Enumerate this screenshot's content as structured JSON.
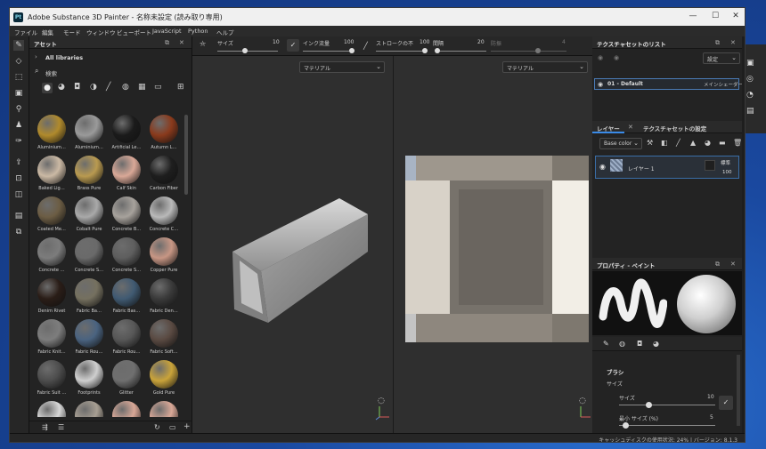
{
  "app": {
    "title": "Adobe Substance 3D Painter - 名称未設定 (読み取り専用)",
    "logo_text": "Pt",
    "controls": [
      "—",
      "☐",
      "✕"
    ]
  },
  "menu": [
    "ファイル",
    "編集",
    "モード",
    "ウィンドウ",
    "ビューポート",
    "JavaScript",
    "Python",
    "ヘルプ"
  ],
  "assets_panel": {
    "title": "アセット",
    "library": "All libraries",
    "search_placeholder": "検索",
    "items": [
      {
        "name": "Aluminium…",
        "color": "#b08a2c"
      },
      {
        "name": "Aluminium…",
        "color": "#9a9a9a"
      },
      {
        "name": "Artificial Le…",
        "color": "#1b1b1b"
      },
      {
        "name": "Autumn L…",
        "color": "#8a3a1c"
      },
      {
        "name": "Baked Lig…",
        "color": "#cbb9a4"
      },
      {
        "name": "Brass Pure",
        "color": "#b99a50"
      },
      {
        "name": "Calf Skin",
        "color": "#d9a897"
      },
      {
        "name": "Carbon Fiber",
        "color": "#1e1e1e"
      },
      {
        "name": "Coated Me…",
        "color": "#6c5d44"
      },
      {
        "name": "Cobalt Pure",
        "color": "#a9a9a9"
      },
      {
        "name": "Concrete B…",
        "color": "#a7a29c"
      },
      {
        "name": "Concrete C…",
        "color": "#b9b9b9"
      },
      {
        "name": "Concrete …",
        "color": "#7c7c7c"
      },
      {
        "name": "Concrete S…",
        "color": "#6a6a6a"
      },
      {
        "name": "Concrete S…",
        "color": "#5e5e5e"
      },
      {
        "name": "Copper Pure",
        "color": "#c79684"
      },
      {
        "name": "Denim Rivet",
        "color": "#2a1d17"
      },
      {
        "name": "Fabric Ba…",
        "color": "#75705f"
      },
      {
        "name": "Fabric Bas…",
        "color": "#405a72"
      },
      {
        "name": "Fabric Den…",
        "color": "#3a3a3a"
      },
      {
        "name": "Fabric Knit…",
        "color": "#7d7d7d"
      },
      {
        "name": "Fabric Rou…",
        "color": "#4a6380"
      },
      {
        "name": "Fabric Rou…",
        "color": "#575757"
      },
      {
        "name": "Fabric Soft…",
        "color": "#5a4a42"
      },
      {
        "name": "Fabric Suit …",
        "color": "#4d4d4d"
      },
      {
        "name": "Footprints",
        "color": "#cfcfcf"
      },
      {
        "name": "Glitter",
        "color": "#6f6f6f"
      },
      {
        "name": "Gold Pure",
        "color": "#c9a33a"
      },
      {
        "name": "",
        "color": "#d8d8d8"
      },
      {
        "name": "",
        "color": "#a89f93"
      },
      {
        "name": "",
        "color": "#d9a897"
      },
      {
        "name": "",
        "color": "#d9a897"
      }
    ]
  },
  "viewport_toolbar": {
    "size_label": "サイズ",
    "size_value": "10",
    "flow_label": "インク流量",
    "flow_value": "100",
    "stroke_label": "ストロークの不",
    "stroke_value": "100",
    "spacing_label": "間隔",
    "spacing_value": "20",
    "jitter_label": "防振",
    "jitter_value": "4"
  },
  "viewport3d": {
    "dropdown": "マテリアル"
  },
  "viewport2d": {
    "dropdown": "マテリアル"
  },
  "texture_sets": {
    "title": "テクスチャセットのリスト",
    "settings": "設定",
    "item": "01 - Default",
    "shader": "メインシェーダー"
  },
  "layers": {
    "tab_layers": "レイヤー",
    "tab_settings": "テクスチャセットの設定",
    "channel": "Base color",
    "layer_name": "レイヤー 1",
    "blend": "標準",
    "opacity": "100"
  },
  "properties": {
    "title": "プロパティ - ペイント",
    "section": "ブラシ",
    "size_group": "サイズ",
    "size_label": "サイズ",
    "size_value": "10",
    "min_size_label": "最小 サイズ (%)",
    "min_size_value": "5"
  },
  "status": {
    "text": "キャッシュディスクの使用状況: 24% | バージョン: 8.1.3"
  }
}
